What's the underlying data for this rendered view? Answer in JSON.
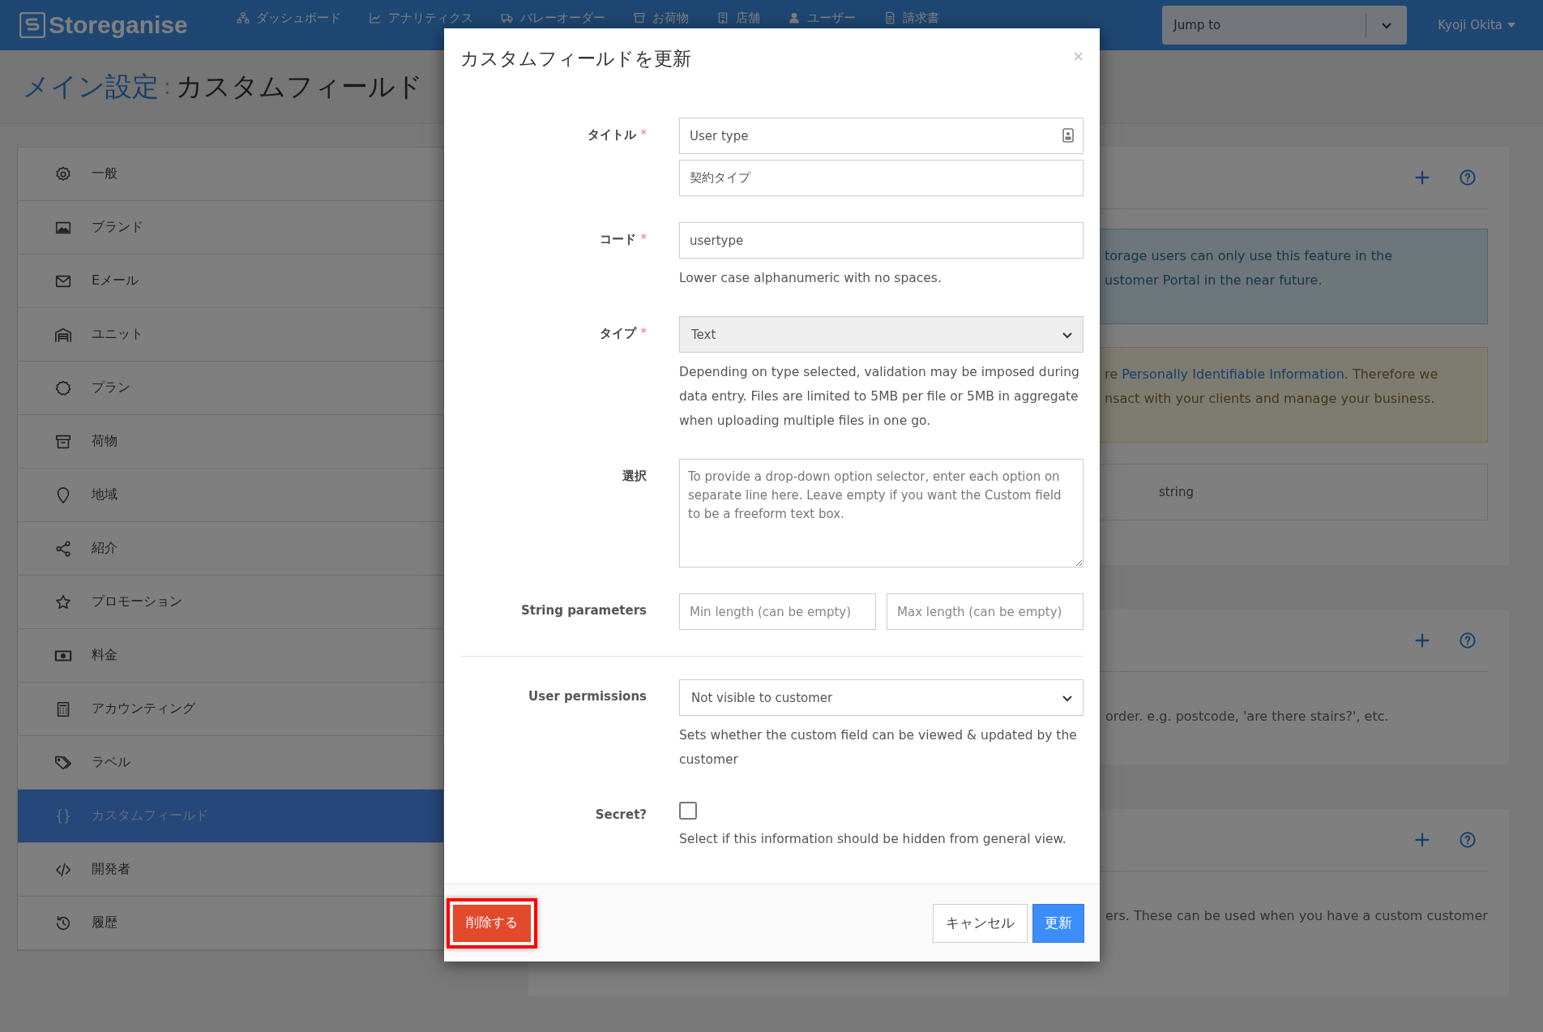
{
  "nav": {
    "logo": "Storeganise",
    "items": [
      {
        "label": "ダッシュボード"
      },
      {
        "label": "アナリティクス"
      },
      {
        "label": "バレーオーダー"
      },
      {
        "label": "お荷物"
      },
      {
        "label": "店舗"
      },
      {
        "label": "ユーザー"
      },
      {
        "label": "請求書"
      }
    ],
    "jump_to": {
      "placeholder": "Jump to"
    },
    "user": "Kyoji Okita"
  },
  "page_title": {
    "parent": "メイン設定",
    "separator": ":",
    "current": "カスタムフィールド"
  },
  "sidebar": {
    "items": [
      {
        "label": "一般",
        "selected": false
      },
      {
        "label": "ブランド",
        "selected": false
      },
      {
        "label": "Eメール",
        "selected": false
      },
      {
        "label": "ユニット",
        "selected": false
      },
      {
        "label": "プラン",
        "selected": false
      },
      {
        "label": "荷物",
        "selected": false
      },
      {
        "label": "地域",
        "selected": false
      },
      {
        "label": "紹介",
        "selected": false
      },
      {
        "label": "プロモーション",
        "selected": false
      },
      {
        "label": "料金",
        "selected": false
      },
      {
        "label": "アカウンティング",
        "selected": false
      },
      {
        "label": "ラベル",
        "selected": false
      },
      {
        "label": "カスタムフィールド",
        "selected": true
      },
      {
        "label": "開発者",
        "selected": false
      },
      {
        "label": "履歴",
        "selected": false
      }
    ]
  },
  "cards": [
    {
      "info": [
        "torage users can only use this feature in the",
        "ustomer Portal in the near future."
      ],
      "warning": {
        "before": "re ",
        "link": "Personally Identifiable Information",
        "after": ". Therefore we",
        "line2": "nsact with your clients and manage your business."
      },
      "table_cell": "string"
    },
    {
      "text": "order. e.g. postcode, 'are there stairs?', etc."
    },
    {
      "text": "ers. These can be used when you have a custom customer"
    }
  ],
  "modal": {
    "title": "カスタムフィールドを更新",
    "close": "×",
    "required_mark": "*",
    "title_field": {
      "label": "タイトル",
      "required": true,
      "value": "User type",
      "translation": "契約タイプ"
    },
    "code_field": {
      "label": "コード",
      "required": true,
      "value": "usertype",
      "help": "Lower case alphanumeric with no spaces."
    },
    "type_field": {
      "label": "タイプ",
      "required": true,
      "value": "Text",
      "disabled": true,
      "help": "Depending on type selected, validation may be imposed during data entry. Files are limited to 5MB per file or 5MB in aggregate when uploading multiple files in one go."
    },
    "choice_field": {
      "label": "選択",
      "placeholder": "To provide a drop-down option selector, enter each option on separate line here. Leave empty if you want the Custom field to be a freeform text box."
    },
    "string_parameters": {
      "label": "String parameters",
      "min_placeholder": "Min length (can be empty)",
      "max_placeholder": "Max length (can be empty)"
    },
    "permissions_field": {
      "label": "User permissions",
      "value": "Not visible to customer",
      "help": "Sets whether the custom field can be viewed & updated by the customer"
    },
    "secret_field": {
      "label": "Secret?",
      "checked": false,
      "help": "Select if this information should be hidden from general view."
    },
    "delete_button": {
      "label": "削除する",
      "highlighted": true
    },
    "cancel_button": "キャンセル",
    "update_button": "更新"
  }
}
